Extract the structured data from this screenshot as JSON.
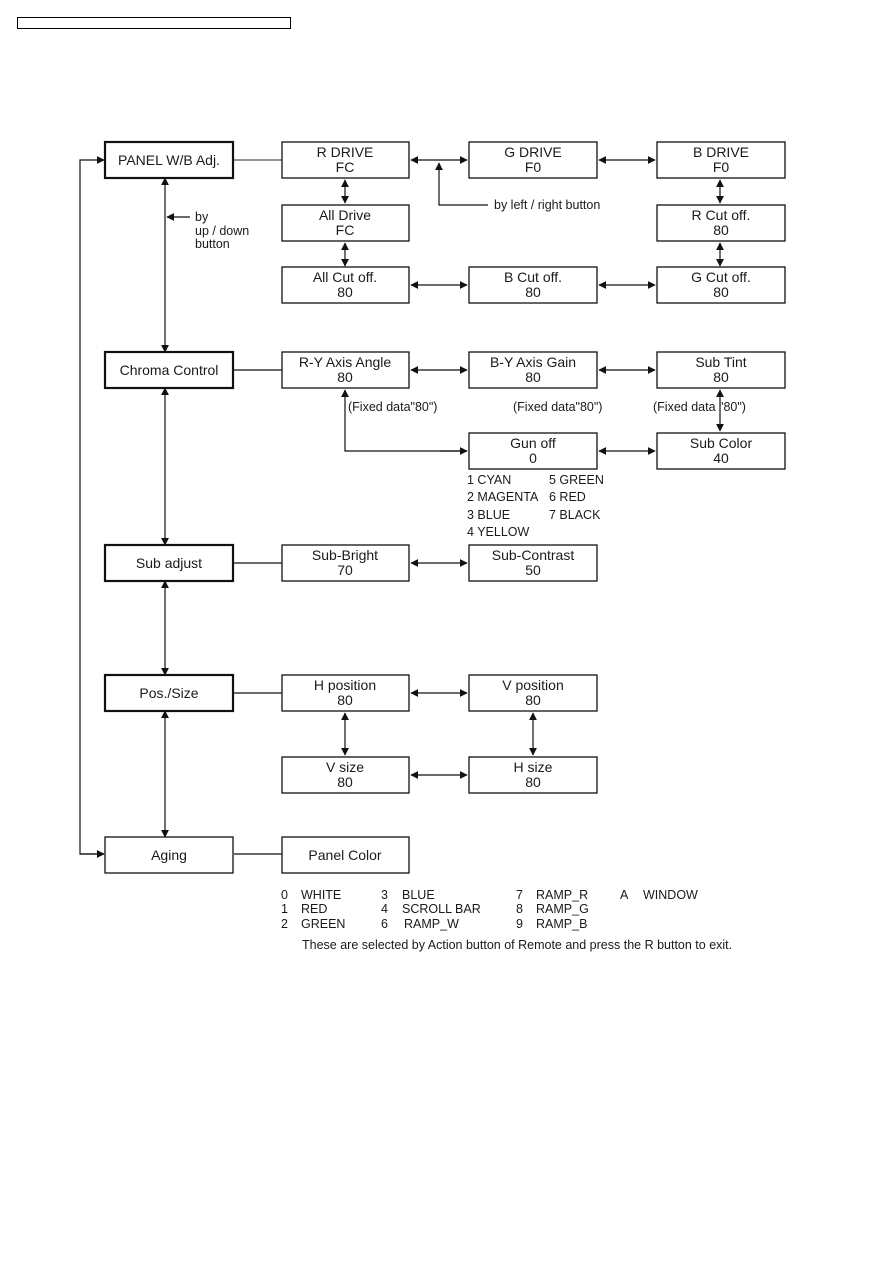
{
  "header": {
    "label": ""
  },
  "main_menu": [
    {
      "id": "panel-wb",
      "label": "PANEL W/B Adj."
    },
    {
      "id": "chroma",
      "label": "Chroma Control"
    },
    {
      "id": "sub-adjust",
      "label": "Sub adjust"
    },
    {
      "id": "pos-size",
      "label": "Pos./Size"
    },
    {
      "id": "aging",
      "label": "Aging"
    }
  ],
  "panel_wb": {
    "r_drive": {
      "name": "R DRIVE",
      "value": "FC"
    },
    "g_drive": {
      "name": "G DRIVE",
      "value": "F0"
    },
    "b_drive": {
      "name": "B DRIVE",
      "value": "F0"
    },
    "all_drive": {
      "name": "All Drive",
      "value": "FC"
    },
    "r_cutoff": {
      "name": "R Cut off.",
      "value": "80"
    },
    "all_cutoff": {
      "name": "All Cut off.",
      "value": "80"
    },
    "b_cutoff": {
      "name": "B Cut off.",
      "value": "80"
    },
    "g_cutoff": {
      "name": "G Cut off.",
      "value": "80"
    }
  },
  "chroma": {
    "ry_angle": {
      "name": "R-Y Axis Angle",
      "value": "80"
    },
    "by_gain": {
      "name": "B-Y Axis Gain",
      "value": "80"
    },
    "sub_tint": {
      "name": "Sub Tint",
      "value": "80"
    },
    "gun_off": {
      "name": "Gun off",
      "value": "0"
    },
    "sub_color": {
      "name": "Sub Color",
      "value": "40"
    },
    "fixed_note_1": "(Fixed data\"80\")",
    "fixed_note_2": "(Fixed data\"80\")",
    "fixed_note_3": "(Fixed data \"80\")",
    "gun_off_options": [
      "1 CYAN",
      "2 MAGENTA",
      "3 BLUE",
      "4 YELLOW",
      "5 GREEN",
      "6 RED",
      "7 BLACK"
    ]
  },
  "sub_adjust": {
    "sub_bright": {
      "name": "Sub-Bright",
      "value": "70"
    },
    "sub_contrast": {
      "name": "Sub-Contrast",
      "value": "50"
    }
  },
  "pos_size": {
    "h_position": {
      "name": "H position",
      "value": "80"
    },
    "v_position": {
      "name": "V position",
      "value": "80"
    },
    "v_size": {
      "name": "V size",
      "value": "80"
    },
    "h_size": {
      "name": "H size",
      "value": "80"
    }
  },
  "aging": {
    "panel_color": {
      "name": "Panel Color"
    },
    "options": [
      {
        "code": "0",
        "name": "WHITE"
      },
      {
        "code": "1",
        "name": "RED"
      },
      {
        "code": "2",
        "name": "GREEN"
      },
      {
        "code": "3",
        "name": "BLUE"
      },
      {
        "code": "4",
        "name": "SCROLL BAR"
      },
      {
        "code": "6",
        "name": "RAMP_W"
      },
      {
        "code": "7",
        "name": "RAMP_R"
      },
      {
        "code": "8",
        "name": "RAMP_G"
      },
      {
        "code": "9",
        "name": "RAMP_B"
      },
      {
        "code": "A",
        "name": "WINDOW"
      }
    ],
    "footnote": "These are selected by Action button of Remote and press the R button to exit."
  },
  "annotations": {
    "up_down_line1": "by",
    "up_down_line2": "up / down",
    "up_down_line3": "button",
    "left_right": "by left / right button"
  }
}
